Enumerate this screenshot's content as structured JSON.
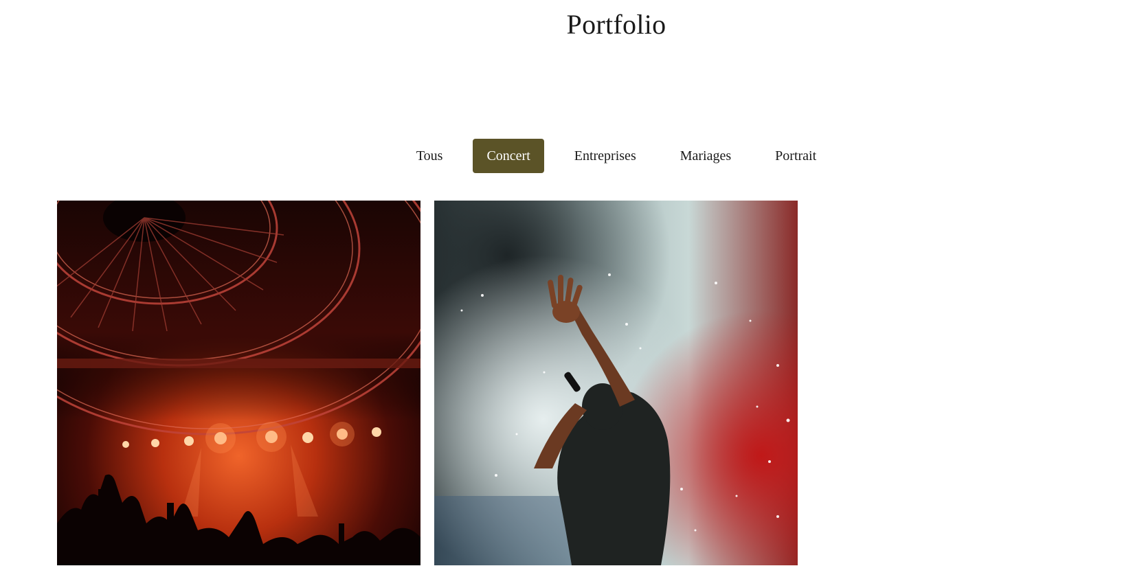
{
  "page": {
    "title": "Portfolio"
  },
  "filters": [
    {
      "label": "Tous",
      "active": false
    },
    {
      "label": "Concert",
      "active": true
    },
    {
      "label": "Entreprises",
      "active": false
    },
    {
      "label": "Mariages",
      "active": false
    },
    {
      "label": "Portrait",
      "active": false
    }
  ],
  "colors": {
    "accent": "#5b5327",
    "background": "#ffffff",
    "text": "#1a1a1a"
  },
  "gallery": {
    "items": [
      {
        "subject": "concert-stage-red-lights"
      },
      {
        "subject": "singer-smoke-raised-hand"
      }
    ]
  }
}
